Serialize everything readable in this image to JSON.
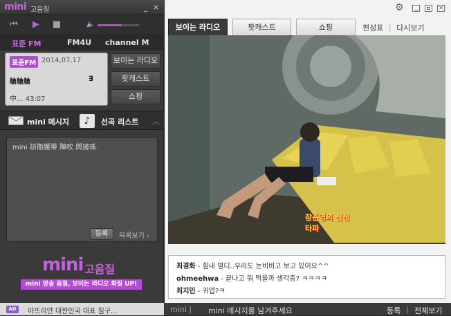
{
  "app": {
    "logo": "mini",
    "subtitle": "고음질"
  },
  "window_controls": {
    "minimize": "_",
    "close": "×"
  },
  "player": {
    "prev": "⏮",
    "play": "▶",
    "stop": "■",
    "volume_icon": "🔈",
    "volume_level_percent": 58
  },
  "channels": [
    {
      "label": "표준 FM",
      "active": true
    },
    {
      "label": "FM4U",
      "active": false
    },
    {
      "label": "channel M",
      "active": false
    }
  ],
  "now_playing": {
    "badge": "표준FM",
    "date": "2014,07,17",
    "program": "艙艙艙",
    "program_mark": "∃",
    "status": "中... 43:07"
  },
  "side_buttons": [
    "보이는 라디오",
    "팟캐스트",
    "쇼핑"
  ],
  "message_tabs": [
    {
      "label": "mini 메시지",
      "icon": "envelope-icon"
    },
    {
      "label": "선곡 리스트",
      "icon": "music-note-icon"
    }
  ],
  "message_box": {
    "text": "mini 訪衛媛蒂 陣吹 舆據珠.",
    "register": "등록",
    "list_link": "목록보기 ›"
  },
  "promo": {
    "logo": "mini",
    "subtitle": "고음질",
    "banner": "mini 방송 음질, 보이는 라디오 화질 UP!"
  },
  "ad": {
    "badge": "AD",
    "text": "아뜨리얀 대한민국 대표 침구..."
  },
  "right_tabs": [
    {
      "label": "보이는 라디오",
      "active": true
    },
    {
      "label": "팟캐스트",
      "active": false
    },
    {
      "label": "쇼핑",
      "active": false
    }
  ],
  "right_links": {
    "schedule": "편성표",
    "separator": "|",
    "replay": "다시보기"
  },
  "video": {
    "overlay": "장준영의 신신타파"
  },
  "chat": [
    {
      "user": "최경화",
      "msg": " - 힘내 영디..우리도 눈비비고 보고 있어요^^"
    },
    {
      "user": "ohmeehwa",
      "msg": " - 끝나고 뭐 먹을까 생각중? ㅋㅋㅋㅋ"
    },
    {
      "user": "최지민",
      "msg": " - 귀엽?ㅋ"
    }
  ],
  "bottom_bar": {
    "prefix": "mini |",
    "prompt": "mini 메시지를 남겨주세요",
    "register": "등록",
    "separator": "|",
    "view_all": "전체보기"
  }
}
